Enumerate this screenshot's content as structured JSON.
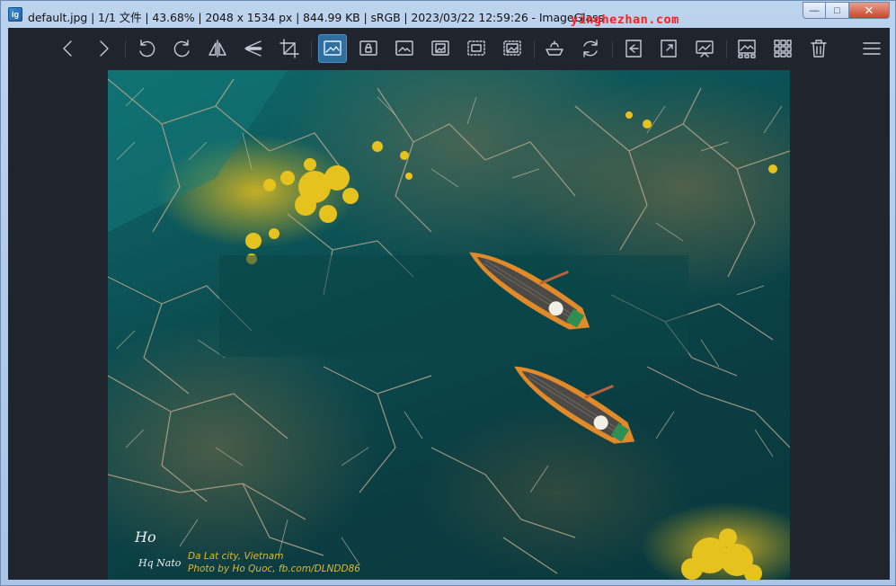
{
  "window": {
    "title": "default.jpg  |  1/1 文件  |  43.68%  |  2048 x 1534 px  |  844.99 KB  |  sRGB  |  2023/03/22 12:59:26  - ImageGlass",
    "app_icon_text": "ig",
    "watermark": "yinghezhan.com",
    "caption_buttons": {
      "minimize": "—",
      "maximize": "□",
      "close": "✕"
    }
  },
  "toolbar": {
    "buttons": [
      {
        "icon": "chevron-left-icon",
        "label": "Previous image"
      },
      {
        "icon": "chevron-right-icon",
        "label": "Next image"
      },
      {
        "icon": "rotate-left-icon",
        "label": "Rotate left"
      },
      {
        "icon": "rotate-right-icon",
        "label": "Rotate right"
      },
      {
        "icon": "flip-horizontal-icon",
        "label": "Flip horizontal"
      },
      {
        "icon": "flip-vertical-icon",
        "label": "Flip vertical"
      },
      {
        "icon": "crop-icon",
        "label": "Crop"
      },
      {
        "icon": "auto-zoom-icon",
        "label": "Auto zoom",
        "active": true
      },
      {
        "icon": "lock-zoom-icon",
        "label": "Lock zoom"
      },
      {
        "icon": "scale-to-width-icon",
        "label": "Scale to width"
      },
      {
        "icon": "scale-to-height-icon",
        "label": "Scale to height"
      },
      {
        "icon": "scale-to-fit-icon",
        "label": "Scale to fit"
      },
      {
        "icon": "scale-to-fill-icon",
        "label": "Scale to fill"
      },
      {
        "icon": "checkerboard-icon",
        "label": "Checkerboard"
      },
      {
        "icon": "refresh-icon",
        "label": "Refresh"
      },
      {
        "icon": "gallery-icon",
        "label": "Gallery"
      },
      {
        "icon": "fullscreen-icon",
        "label": "Full screen"
      },
      {
        "icon": "slideshow-icon",
        "label": "Slideshow"
      },
      {
        "icon": "frameless-icon",
        "label": "Frameless"
      },
      {
        "icon": "thumbnail-grid-icon",
        "label": "Thumbnails"
      },
      {
        "icon": "delete-icon",
        "label": "Delete"
      },
      {
        "icon": "menu-icon",
        "label": "Main menu"
      }
    ]
  },
  "image": {
    "caption_line1": "Da Lat city, Vietnam",
    "caption_line2": "Photo by Ho Quoc, fb.com/DLNDD86",
    "signature_line1": "Ho",
    "signature_line2": "Hq Nato"
  },
  "colors": {
    "viewer_bg": "#1f242d",
    "active_button": "#2f6f9f",
    "water": "#0b4c50",
    "foliage": "#e6be1e",
    "boat": "#e08a2a"
  }
}
